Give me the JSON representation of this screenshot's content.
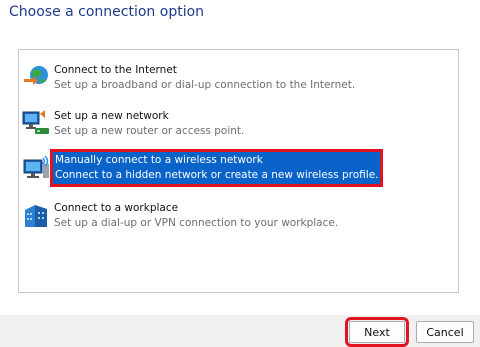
{
  "header": {
    "title": "Choose a connection option"
  },
  "options": [
    {
      "title": "Connect to the Internet",
      "description": "Set up a broadband or dial-up connection to the Internet.",
      "icon": "globe-connection-icon"
    },
    {
      "title": "Set up a new network",
      "description": "Set up a new router or access point.",
      "icon": "router-network-icon"
    },
    {
      "title": "Manually connect to a wireless network",
      "description": "Connect to a hidden network or create a new wireless profile.",
      "icon": "wireless-computer-icon",
      "selected": true
    },
    {
      "title": "Connect to a workplace",
      "description": "Set up a dial-up or VPN connection to your workplace.",
      "icon": "workplace-vpn-icon"
    }
  ],
  "footer": {
    "next_label": "Next",
    "cancel_label": "Cancel"
  },
  "colors": {
    "selection": "#0a63c9",
    "highlight_border": "#e0141e",
    "title": "#1f3b8a"
  }
}
